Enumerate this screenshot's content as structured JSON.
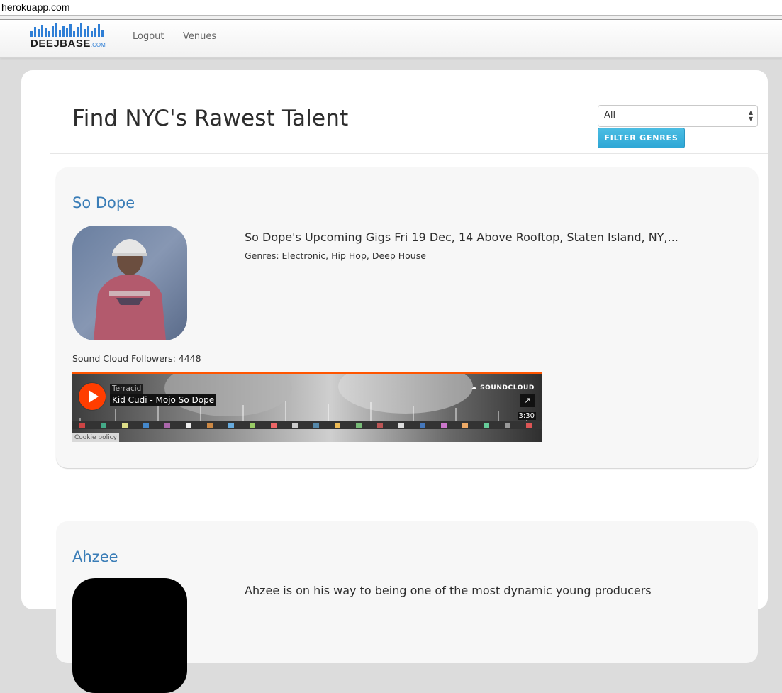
{
  "browser": {
    "url": "herokuapp.com"
  },
  "nav": {
    "logo_text": "DEEJBASE",
    "logo_suffix": ".COM",
    "links": [
      "Logout",
      "Venues"
    ]
  },
  "header": {
    "title": "Find NYC's Rawest Talent",
    "genre_select_value": "All",
    "filter_button": "FILTER GENRES"
  },
  "artists": [
    {
      "name": "So Dope",
      "gigs": "So Dope's Upcoming Gigs Fri 19 Dec, 14 Above Rooftop, Staten Island, NY,...",
      "genres": "Genres: Electronic, Hip Hop, Deep House",
      "followers": "Sound Cloud Followers: 4448",
      "player": {
        "user": "Terracid",
        "track": "Kid Cudi - Mojo So Dope",
        "brand": "SOUNDCLOUD",
        "duration": "3:30",
        "cookie": "Cookie policy"
      }
    },
    {
      "name": "Ahzee",
      "bio": "Ahzee is on his way to being one of the most dynamic young producers"
    }
  ],
  "colors": {
    "accent_link": "#3a7db7",
    "filter_button": "#2ea7d6",
    "soundcloud_orange": "#ff5500",
    "logo_blue": "#2f7fd6"
  }
}
